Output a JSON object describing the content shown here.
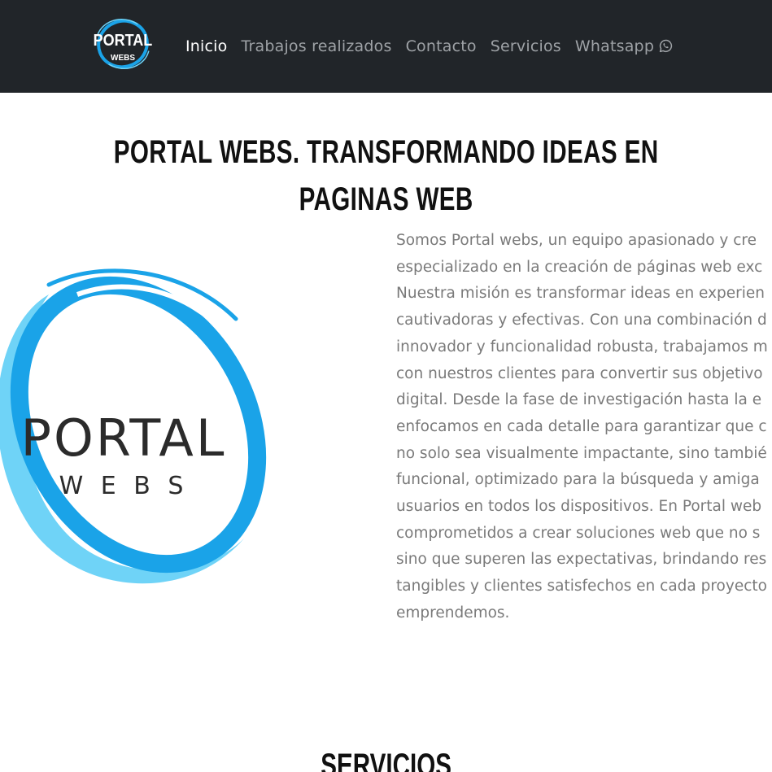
{
  "navbar": {
    "brand_logo": {
      "icon": "portal-webs-logo",
      "line1": "PORTAL",
      "line2": "WEBS"
    },
    "links": [
      {
        "label": "Inicio",
        "active": true
      },
      {
        "label": "Trabajos realizados",
        "active": false
      },
      {
        "label": "Contacto",
        "active": false
      },
      {
        "label": "Servicios",
        "active": false
      },
      {
        "label": "Whatsapp",
        "active": false,
        "icon": "whatsapp-icon"
      }
    ]
  },
  "hero": {
    "title": "Portal webs. Transformando ideas en paginas web",
    "logo": {
      "icon": "portal-webs-logo",
      "word1": "PORTAL",
      "word2": "W E B S"
    },
    "description_lines": [
      "Somos Portal webs, un equipo apasionado y cre",
      "especializado en la creación de páginas web exc",
      "Nuestra misión es transformar ideas en experien",
      "cautivadoras y efectivas. Con una combinación d",
      "innovador y funcionalidad robusta, trabajamos m",
      "con nuestros clientes para convertir sus objetivo",
      "digital. Desde la fase de investigación hasta la e",
      "enfocamos en cada detalle para garantizar que c",
      "no solo sea visualmente impactante, sino tambié",
      "funcional, optimizado para la búsqueda y amiga",
      "usuarios en todos los dispositivos. En Portal web",
      "comprometidos a crear soluciones web que no s",
      "sino que superen las expectativas, brindando res",
      "tangibles y clientes satisfechos en cada proyecto",
      "emprendemos."
    ]
  },
  "services": {
    "title": "Servicios"
  },
  "colors": {
    "navbar_bg": "#212529",
    "link_active": "#ffffff",
    "link_muted": "#9ea2a6",
    "logo_blue": "#1aa3e8",
    "logo_light_blue": "#6fd3f7",
    "body_text": "#7a7a7a"
  }
}
